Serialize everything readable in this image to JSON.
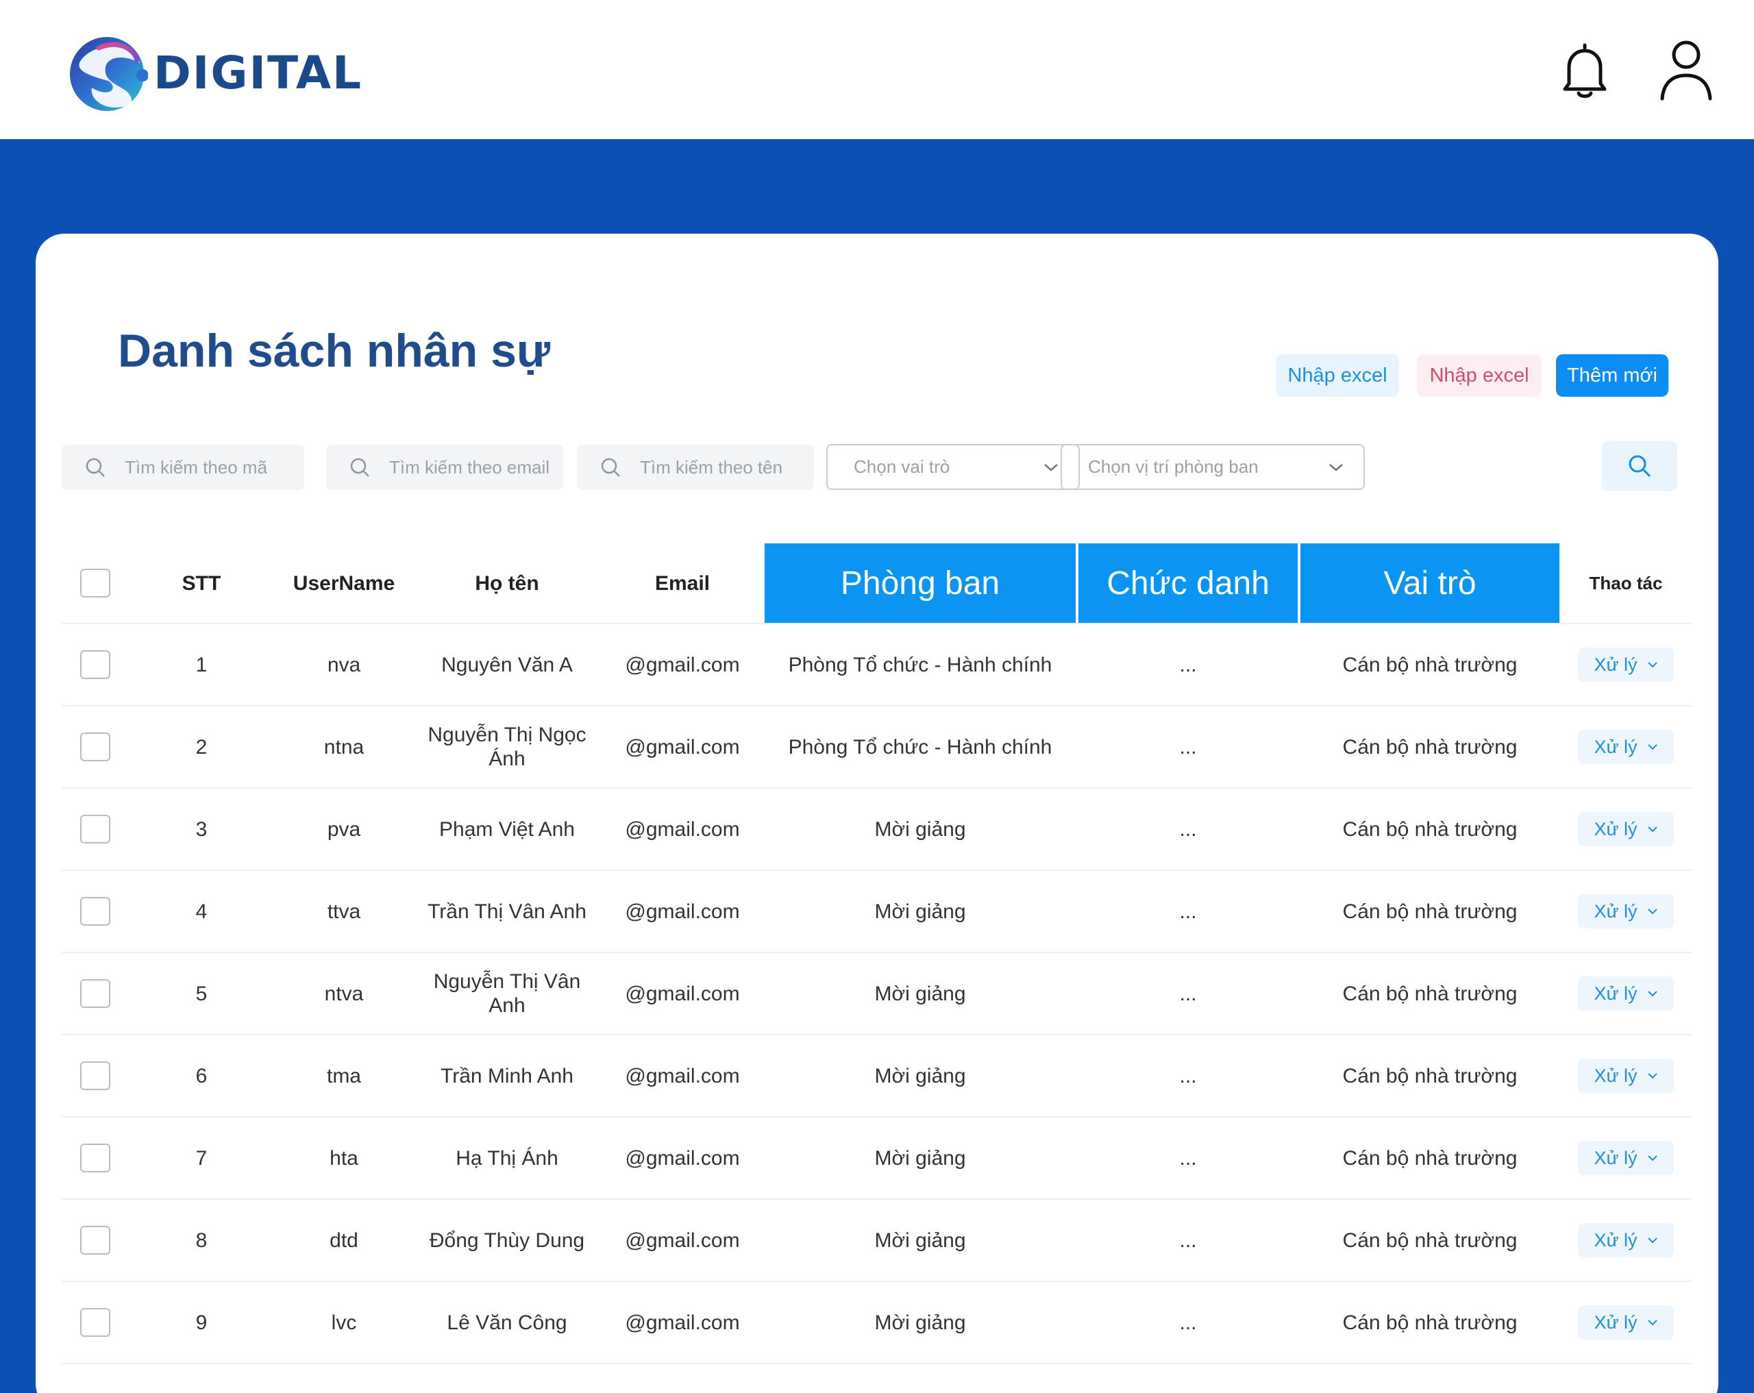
{
  "brand": {
    "name": "DIGITAL"
  },
  "header": {
    "bell_icon": "bell-icon",
    "user_icon": "user-icon"
  },
  "page": {
    "title": "Danh sách nhân sự"
  },
  "actions": {
    "import_label_1": "Nhập excel",
    "import_label_2": "Nhập excel",
    "add_label": "Thêm mới"
  },
  "filters": {
    "search_code": "Tìm kiếm theo mã",
    "search_email": "Tìm kiếm theo email",
    "search_name": "Tìm kiếm theo tên",
    "role_select": "Chọn vai trò",
    "dept_select": "Chọn vị trí phòng ban"
  },
  "table": {
    "columns": [
      "STT",
      "UserName",
      "Họ tên",
      "Email",
      "Phòng ban",
      "Chức danh",
      "Vai trò",
      "Thao tác"
    ],
    "action_label": "Xử lý",
    "rows": [
      [
        "1",
        "nva",
        "Nguyên Văn A",
        "@gmail.com",
        "Phòng Tổ chức - Hành chính",
        "...",
        "Cán bộ nhà trường"
      ],
      [
        "2",
        "ntna",
        "Nguyễn Thị Ngọc Ánh",
        "@gmail.com",
        "Phòng Tổ chức - Hành chính",
        "...",
        "Cán bộ nhà trường"
      ],
      [
        "3",
        "pva",
        "Phạm Việt Anh",
        "@gmail.com",
        "Mời giảng",
        "...",
        "Cán bộ nhà trường"
      ],
      [
        "4",
        "ttva",
        "Trần Thị Vân Anh",
        "@gmail.com",
        "Mời giảng",
        "...",
        "Cán bộ nhà trường"
      ],
      [
        "5",
        "ntva",
        "Nguyễn Thị Vân Anh",
        "@gmail.com",
        "Mời giảng",
        "...",
        "Cán bộ nhà trường"
      ],
      [
        "6",
        "tma",
        "Trần Minh Anh",
        "@gmail.com",
        "Mời giảng",
        "...",
        "Cán bộ nhà trường"
      ],
      [
        "7",
        "hta",
        "Hạ Thị Ánh",
        "@gmail.com",
        "Mời giảng",
        "...",
        "Cán bộ nhà trường"
      ],
      [
        "8",
        "dtd",
        "Đổng Thùy Dung",
        "@gmail.com",
        "Mời giảng",
        "...",
        "Cán bộ nhà trường"
      ],
      [
        "9",
        "lvc",
        "Lê Văn Công",
        "@gmail.com",
        "Mời giảng",
        "...",
        "Cán bộ nhà trường"
      ]
    ]
  },
  "colors": {
    "primary": "#0d50b4",
    "accent": "#0b95f2",
    "title": "#1e4c8c"
  }
}
